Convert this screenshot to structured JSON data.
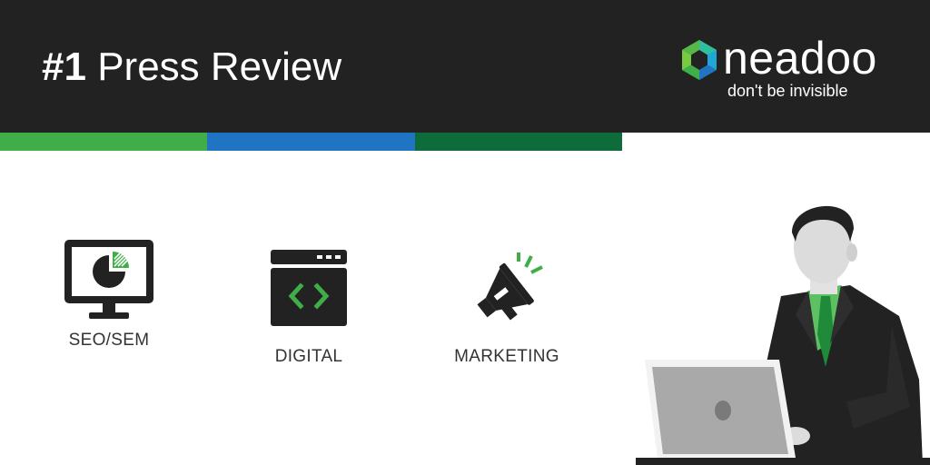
{
  "header": {
    "title_num": "#1",
    "title_rest": "Press Review"
  },
  "logo": {
    "word": "neadoo",
    "tagline": "don't be invisible"
  },
  "features": [
    {
      "label": "SEO/SEM",
      "icon": "monitor-pie-chart-icon"
    },
    {
      "label": "DIGITAL",
      "icon": "browser-code-icon"
    },
    {
      "label": "MARKETING",
      "icon": "megaphone-icon"
    }
  ],
  "colors": {
    "header_bg": "#222222",
    "stripe_green": "#3fae49",
    "stripe_blue": "#1f75c3",
    "stripe_dark_green": "#0e6b3a",
    "accent_green": "#3fae49",
    "icon_dark": "#222222"
  }
}
